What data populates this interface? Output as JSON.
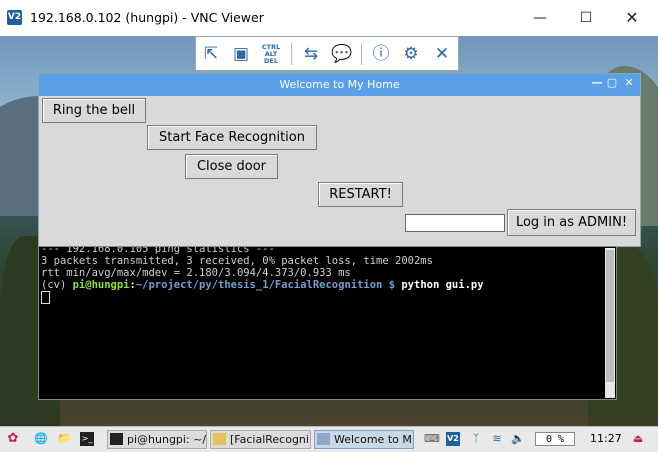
{
  "window": {
    "title": "192.168.0.102 (hungpi) - VNC Viewer",
    "logo": "V2"
  },
  "vnc_toolbar": {
    "icons": [
      "fullscreen-icon",
      "scale-icon",
      "ctrl-alt-del-icon",
      "transfer-icon",
      "chat-icon",
      "info-icon",
      "settings-icon",
      "close-icon"
    ],
    "ctrl_label": "CTRL ALT DEL"
  },
  "app": {
    "title": "Welcome to My Home",
    "ring_label": "Ring the bell",
    "face_label": "Start Face Recognition",
    "close_door_label": "Close door",
    "restart_label": "RESTART!",
    "admin_label": "Log in as ADMIN!",
    "admin_input_value": ""
  },
  "terminal": {
    "line1": "--- 192.168.0.105 ping statistics ---",
    "line2": "3 packets transmitted, 3 received, 0% packet loss, time 2002ms",
    "line3": "rtt min/avg/max/mdev = 2.180/3.094/4.373/0.933 ms",
    "prompt_env": "(cv) ",
    "prompt_user": "pi@hungpi",
    "prompt_colon": ":",
    "prompt_path": "~/project/py/thesis_1/FacialRecognition $",
    "prompt_cmd": " python gui.py"
  },
  "taskbar": {
    "tasks": [
      "pi@hungpi: ~/...",
      "[FacialRecogni...",
      "Welcome to M..."
    ],
    "cpu": "0 %",
    "clock": "11:27"
  },
  "colors": {
    "app_titlebar": "#5aa0e8",
    "vnc_icon": "#2a68a8",
    "prompt_user": "#8ae234",
    "prompt_path": "#729fcf"
  }
}
